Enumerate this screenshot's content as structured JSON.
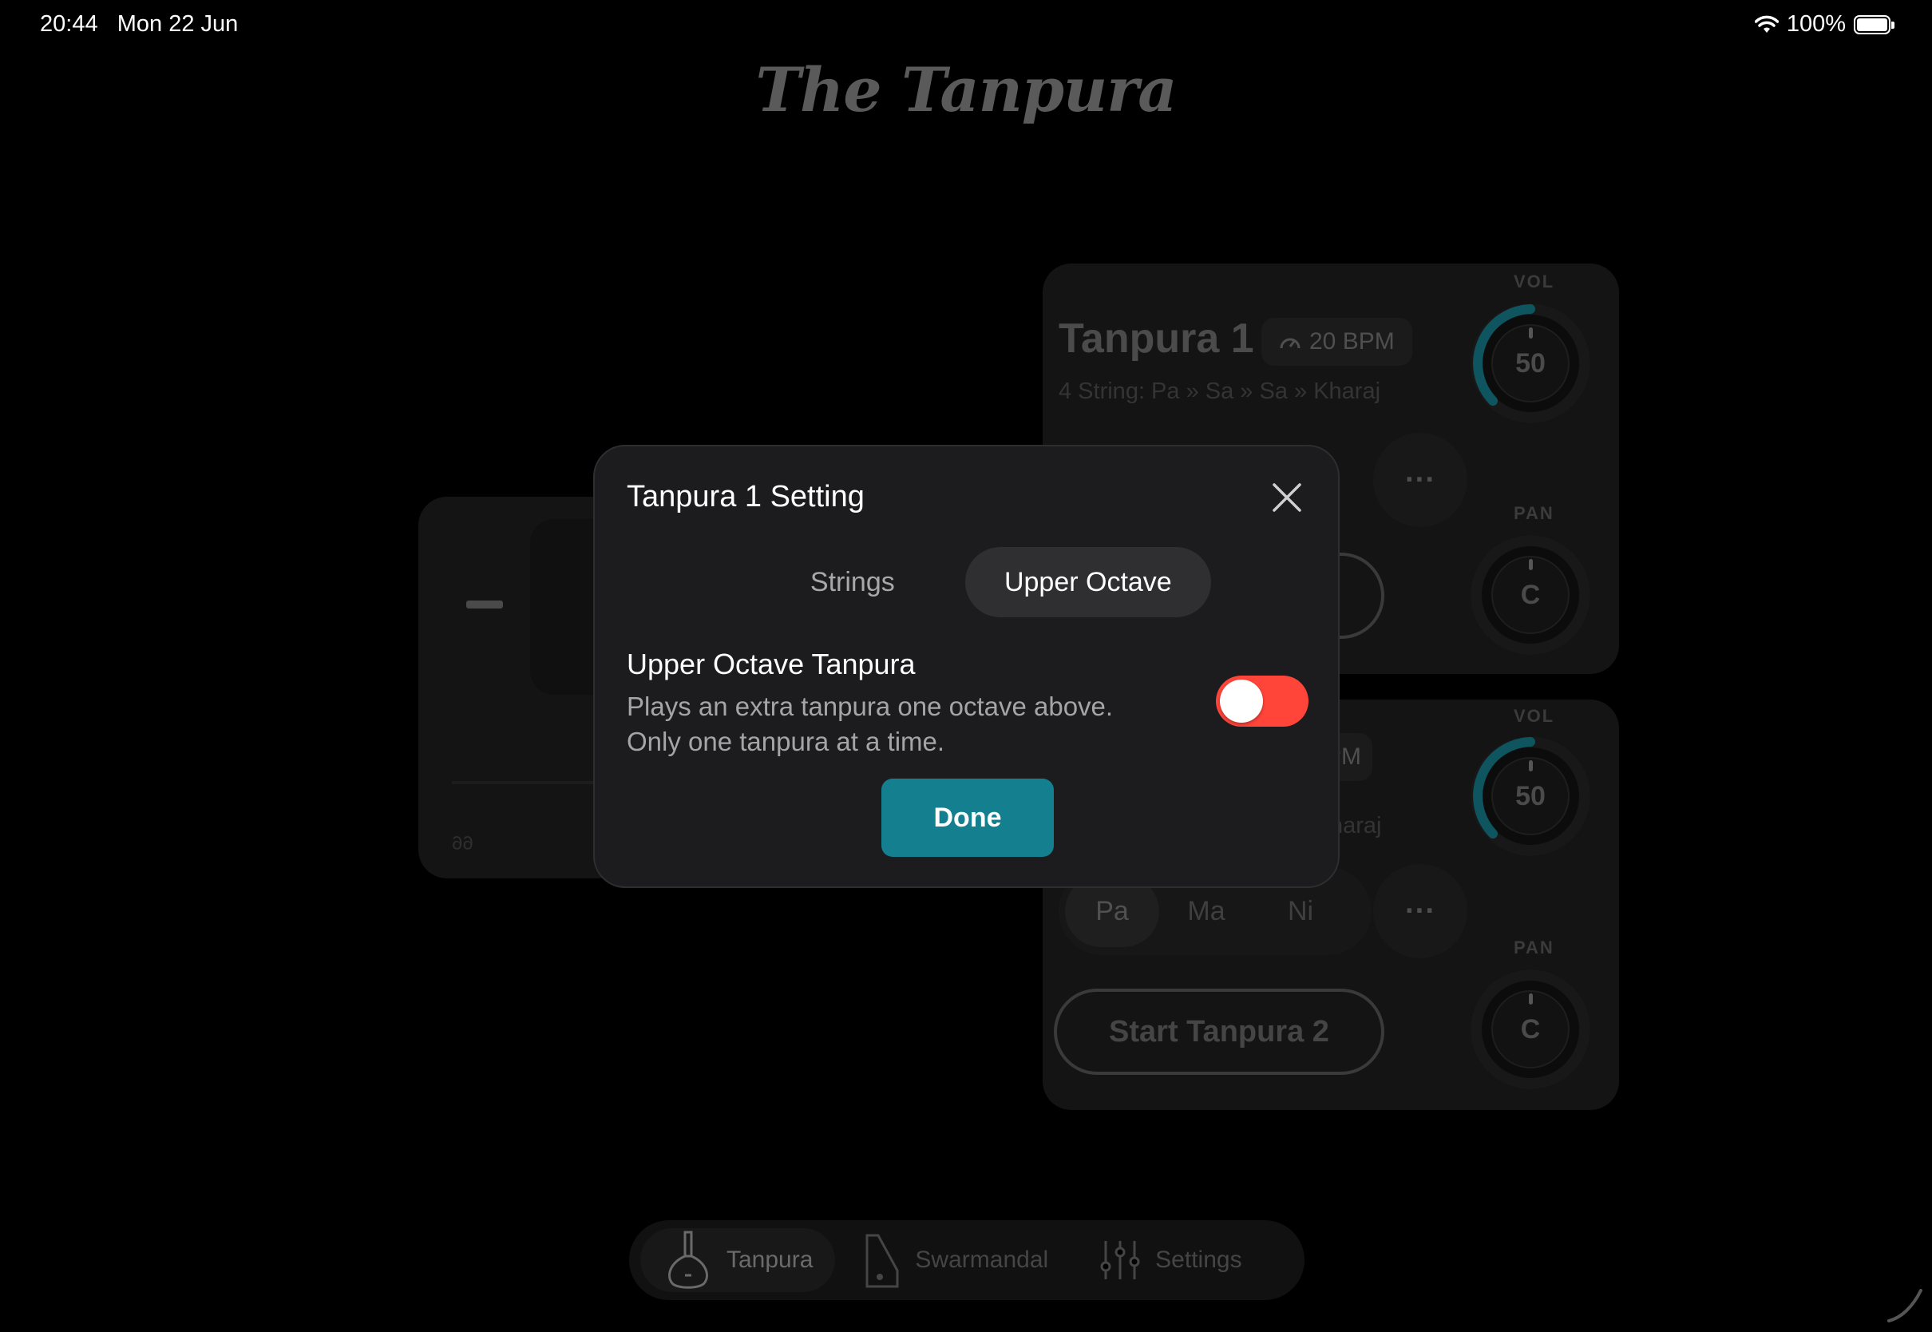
{
  "status_bar": {
    "time": "20:44",
    "date": "Mon 22 Jun",
    "battery": "100%"
  },
  "app": {
    "logo": "The Tanpura"
  },
  "left_card": {
    "minus": "−",
    "value": "99"
  },
  "tanpura1": {
    "title": "Tanpura 1",
    "bpm": "20 BPM",
    "strings": "4 String: Pa » Sa » Sa » Kharaj",
    "more": "···",
    "vol_label": "VOL",
    "vol_value": "50",
    "pan_label": "PAN",
    "pan_value": "C"
  },
  "tanpura2": {
    "bpm_partial": "BPM",
    "strings_partial": "haraj",
    "notes": [
      "Pa",
      "Ma",
      "Ni"
    ],
    "more": "···",
    "start_label": "Start Tanpura 2",
    "vol_label": "VOL",
    "vol_value": "50",
    "pan_label": "PAN",
    "pan_value": "C"
  },
  "modal": {
    "title": "Tanpura 1 Setting",
    "tabs": [
      {
        "label": "Strings",
        "active": false
      },
      {
        "label": "Upper Octave",
        "active": true
      }
    ],
    "option_title": "Upper Octave Tanpura",
    "option_desc_line1": "Plays an extra tanpura one octave above.",
    "option_desc_line2": "Only one tanpura at a time.",
    "toggle_on": false,
    "done_label": "Done"
  },
  "bottom_nav": [
    {
      "label": "Tanpura",
      "icon": "tanpura-icon",
      "active": true
    },
    {
      "label": "Swarmandal",
      "icon": "swarmandal-icon",
      "active": false
    },
    {
      "label": "Settings",
      "icon": "sliders-icon",
      "active": false
    }
  ],
  "colors": {
    "accent": "#147f8f",
    "toggle_off": "#ff453a",
    "knob_arc": "#0f5560"
  }
}
